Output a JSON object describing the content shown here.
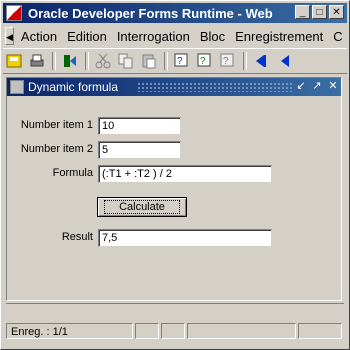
{
  "window": {
    "title": "Oracle Developer Forms Runtime - Web"
  },
  "menu": {
    "items": [
      {
        "label": "Action"
      },
      {
        "label": "Edition"
      },
      {
        "label": "Interrogation"
      },
      {
        "label": "Bloc"
      },
      {
        "label": "Enregistrement"
      },
      {
        "label": "C"
      }
    ]
  },
  "toolbar": {
    "icons": [
      "save-icon",
      "print-icon",
      "exit-icon",
      "cut-icon",
      "copy-icon",
      "paste-icon",
      "query-icon",
      "execute-query-icon",
      "cancel-query-icon",
      "previous-block-icon",
      "previous-record-icon"
    ]
  },
  "form": {
    "title": "Dynamic formula",
    "number1_label": "Number item 1",
    "number1_value": "10",
    "number2_label": "Number item 2",
    "number2_value": "5",
    "formula_label": "Formula",
    "formula_value": "(:T1 + :T2 ) / 2",
    "calculate_label": "Calculate",
    "result_label": "Result",
    "result_value": "7,5"
  },
  "status": {
    "record": "Enreg. : 1/1"
  }
}
